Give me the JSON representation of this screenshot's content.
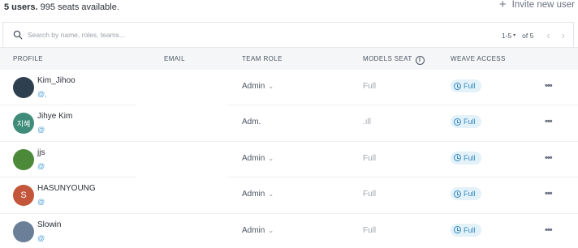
{
  "summary": {
    "count": "5 users.",
    "seats": "995 seats available."
  },
  "invite": {
    "icon": "plus-icon",
    "label": "Invite new user"
  },
  "search": {
    "placeholder": "Search by name, roles, teams...",
    "icon": "search-icon"
  },
  "pager": {
    "range": "1-5",
    "of": "of 5",
    "prev_icon": "chevron-left-icon",
    "next_icon": "chevron-right-icon"
  },
  "columns": {
    "profile": "PROFILE",
    "email": "EMAIL",
    "team_role": "TEAM ROLE",
    "models_seat": "MODELS SEAT",
    "weave_access": "WEAVE ACCESS"
  },
  "users": [
    {
      "name": "Kim_Jihoo",
      "at": "@,",
      "role": "Admin",
      "role_chevron": true,
      "seat": "Full",
      "weave": "Full",
      "avatar_text": "",
      "avatar_color": "#2e3f4f"
    },
    {
      "name": "Jihye Kim",
      "at": "@",
      "role": "Adm.",
      "role_chevron": false,
      "seat": ".ıll",
      "weave": "Full",
      "avatar_text": "지혜",
      "avatar_color": "#3f8c7a"
    },
    {
      "name": "jjs",
      "at": "@",
      "role": "Admin",
      "role_chevron": true,
      "seat": "Full",
      "weave": "Full",
      "avatar_text": "",
      "avatar_color": "#4c8a3a"
    },
    {
      "name": "HASUNYOUNG",
      "at": "@",
      "role": "Admin",
      "role_chevron": true,
      "seat": "Full",
      "weave": "Full",
      "avatar_text": "S",
      "avatar_color": "#c2553a"
    },
    {
      "name": "Slowin",
      "at": "@",
      "role": "Admin",
      "role_chevron": true,
      "seat": "Full",
      "weave": "Full",
      "avatar_text": "",
      "avatar_color": "#6b7f98"
    }
  ],
  "colors": {
    "accent": "#2f86bf",
    "badge_bg": "#e3f1f9",
    "header_bg": "#f5f6f8"
  }
}
